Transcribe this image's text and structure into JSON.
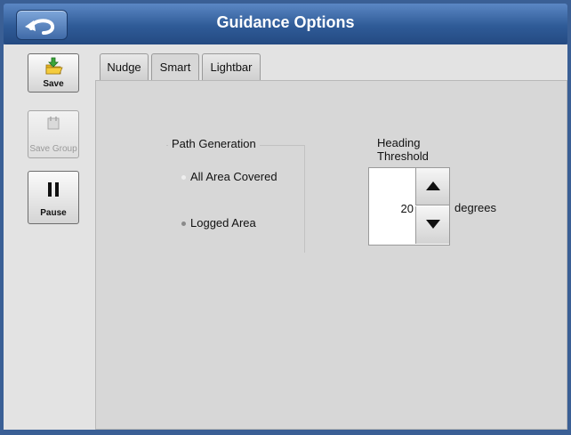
{
  "window": {
    "title": "Guidance Options"
  },
  "toolbar": {
    "save_label": "Save",
    "save_group_label": "Save Group",
    "pause_label": "Pause"
  },
  "tabs": [
    {
      "label": "Nudge",
      "active": false
    },
    {
      "label": "Smart",
      "active": true
    },
    {
      "label": "Lightbar",
      "active": false
    }
  ],
  "path_generation": {
    "label": "Path Generation",
    "options": [
      {
        "label": "All Area Covered",
        "selected": false
      },
      {
        "label": "Logged Area",
        "selected": true
      }
    ]
  },
  "heading_threshold": {
    "label_line1": "Heading",
    "label_line2": "Threshold",
    "value": "20",
    "unit": "degrees"
  },
  "colors": {
    "titlebar": "#2f5b97",
    "frame": "#3a5f95",
    "panel": "#d7d7d7"
  },
  "icons": {
    "back": "back-arrow-icon",
    "save": "save-folder-icon",
    "save_group": "save-group-icon",
    "pause": "pause-icon",
    "up": "up-arrow-icon",
    "down": "down-arrow-icon"
  }
}
